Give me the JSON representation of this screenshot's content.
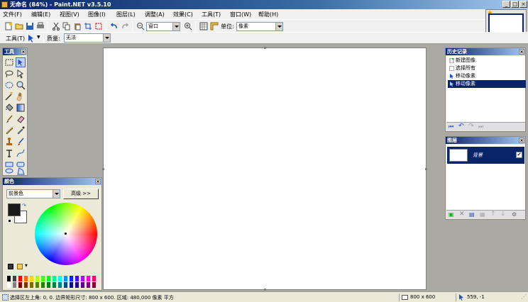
{
  "window": {
    "title": "无命名 (84%) - Paint.NET v3.5.10",
    "minimize": "_",
    "maximize": "□",
    "close": "×"
  },
  "menu": [
    "文件(F)",
    "编辑(E)",
    "视图(V)",
    "图像(I)",
    "图层(L)",
    "调整(A)",
    "效果(C)",
    "工具(T)",
    "窗口(W)",
    "帮助(H)"
  ],
  "toolbar": {
    "zoom_value": "窗口",
    "units_label": "单位:",
    "units_value": "像素"
  },
  "toolbar2": {
    "tool_label": "工具(T)",
    "quality_label": "质量:",
    "quality_value": "无法"
  },
  "tools_panel": {
    "title": "工具"
  },
  "colors_panel": {
    "title": "颜色",
    "mode_value": "前景色",
    "advanced_label": "高级 >>",
    "primary_color": "#1a1a1a",
    "secondary_color": "#ffffff",
    "palette": [
      "#000000",
      "#404040",
      "#ff0000",
      "#ff6a00",
      "#ffd800",
      "#b6ff00",
      "#4cff00",
      "#00ff21",
      "#00ff90",
      "#00ffff",
      "#0094ff",
      "#0026ff",
      "#4800ff",
      "#b200ff",
      "#ff00dc",
      "#ff006e",
      "#ffffff",
      "#808080",
      "#7f0000",
      "#7f3300",
      "#7f6a00",
      "#5b7f00",
      "#267f00",
      "#007f0e",
      "#007f46",
      "#007f7f",
      "#004a7f",
      "#00137f",
      "#21007f",
      "#57007f",
      "#7f006e",
      "#7f0037"
    ]
  },
  "history_panel": {
    "title": "历史记录",
    "items": [
      "新建图像",
      "选择所有",
      "移动像素",
      "移动像素"
    ],
    "selected_index": 3
  },
  "layers_panel": {
    "title": "图层",
    "layer_name": "背景",
    "visible_check": "✔"
  },
  "status": {
    "selection_info": "选择区左上角: 0, 0. 边界矩形尺寸: 800 x 600. 区域: 480,000 像素 平方",
    "image_size": "800 x 600",
    "cursor_pos": "559, -1"
  }
}
